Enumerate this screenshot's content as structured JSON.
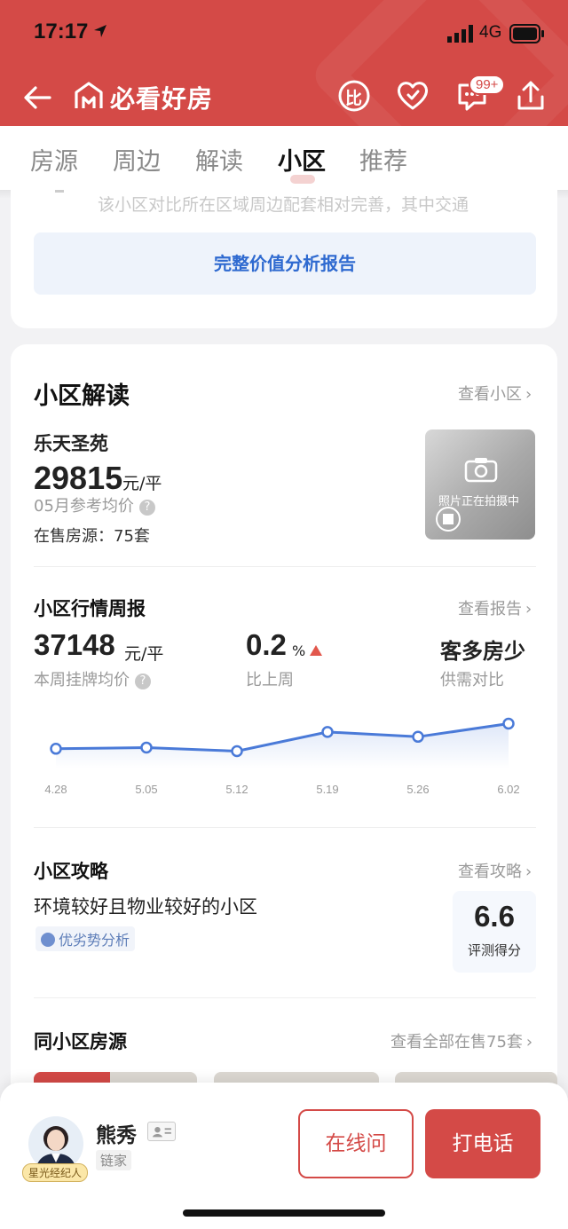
{
  "status": {
    "time": "17:17",
    "network": "4G"
  },
  "nav": {
    "title": "必看好房",
    "compare_label": "比",
    "badge": "99+"
  },
  "tabs": [
    "房源",
    "周边",
    "解读",
    "小区",
    "推荐"
  ],
  "analysis": {
    "faded_text": "该小区对比所在区域周边配套相对完善，其中交通",
    "report_button": "完整价值分析报告"
  },
  "community": {
    "section_title": "小区解读",
    "view_link": "查看小区",
    "name": "乐天圣苑",
    "price": "29815",
    "price_unit": "元/平",
    "price_note": "05月参考均价",
    "on_sale": "在售房源：75套",
    "photo_text": "照片正在拍摄中"
  },
  "weekly": {
    "title": "小区行情周报",
    "view_link": "查看报告",
    "listing_price": "37148",
    "listing_unit": "元/平",
    "listing_label": "本周挂牌均价",
    "change": "0.2",
    "change_unit": "%",
    "change_label": "比上周",
    "supply": "客多房少",
    "supply_label": "供需对比"
  },
  "chart_data": {
    "type": "line",
    "categories": [
      "4.28",
      "5.05",
      "5.12",
      "5.19",
      "5.26",
      "6.02"
    ],
    "values": [
      36100,
      36150,
      36000,
      36800,
      36600,
      37148
    ],
    "ylim": [
      35500,
      37500
    ],
    "color": "#4a7ad8"
  },
  "strategy": {
    "title": "小区攻略",
    "view_link": "查看攻略",
    "text": "环境较好且物业较好的小区",
    "tag": "优劣势分析",
    "score": "6.6",
    "score_label": "评测得分"
  },
  "same": {
    "title": "同小区房源",
    "view_link": "查看全部在售75套"
  },
  "agent": {
    "name": "熊秀",
    "company": "链家",
    "badge": "星光经纪人",
    "online_button": "在线问",
    "call_button": "打电话"
  },
  "colors": {
    "brand": "#d44a47",
    "link": "#2f6ad0"
  }
}
